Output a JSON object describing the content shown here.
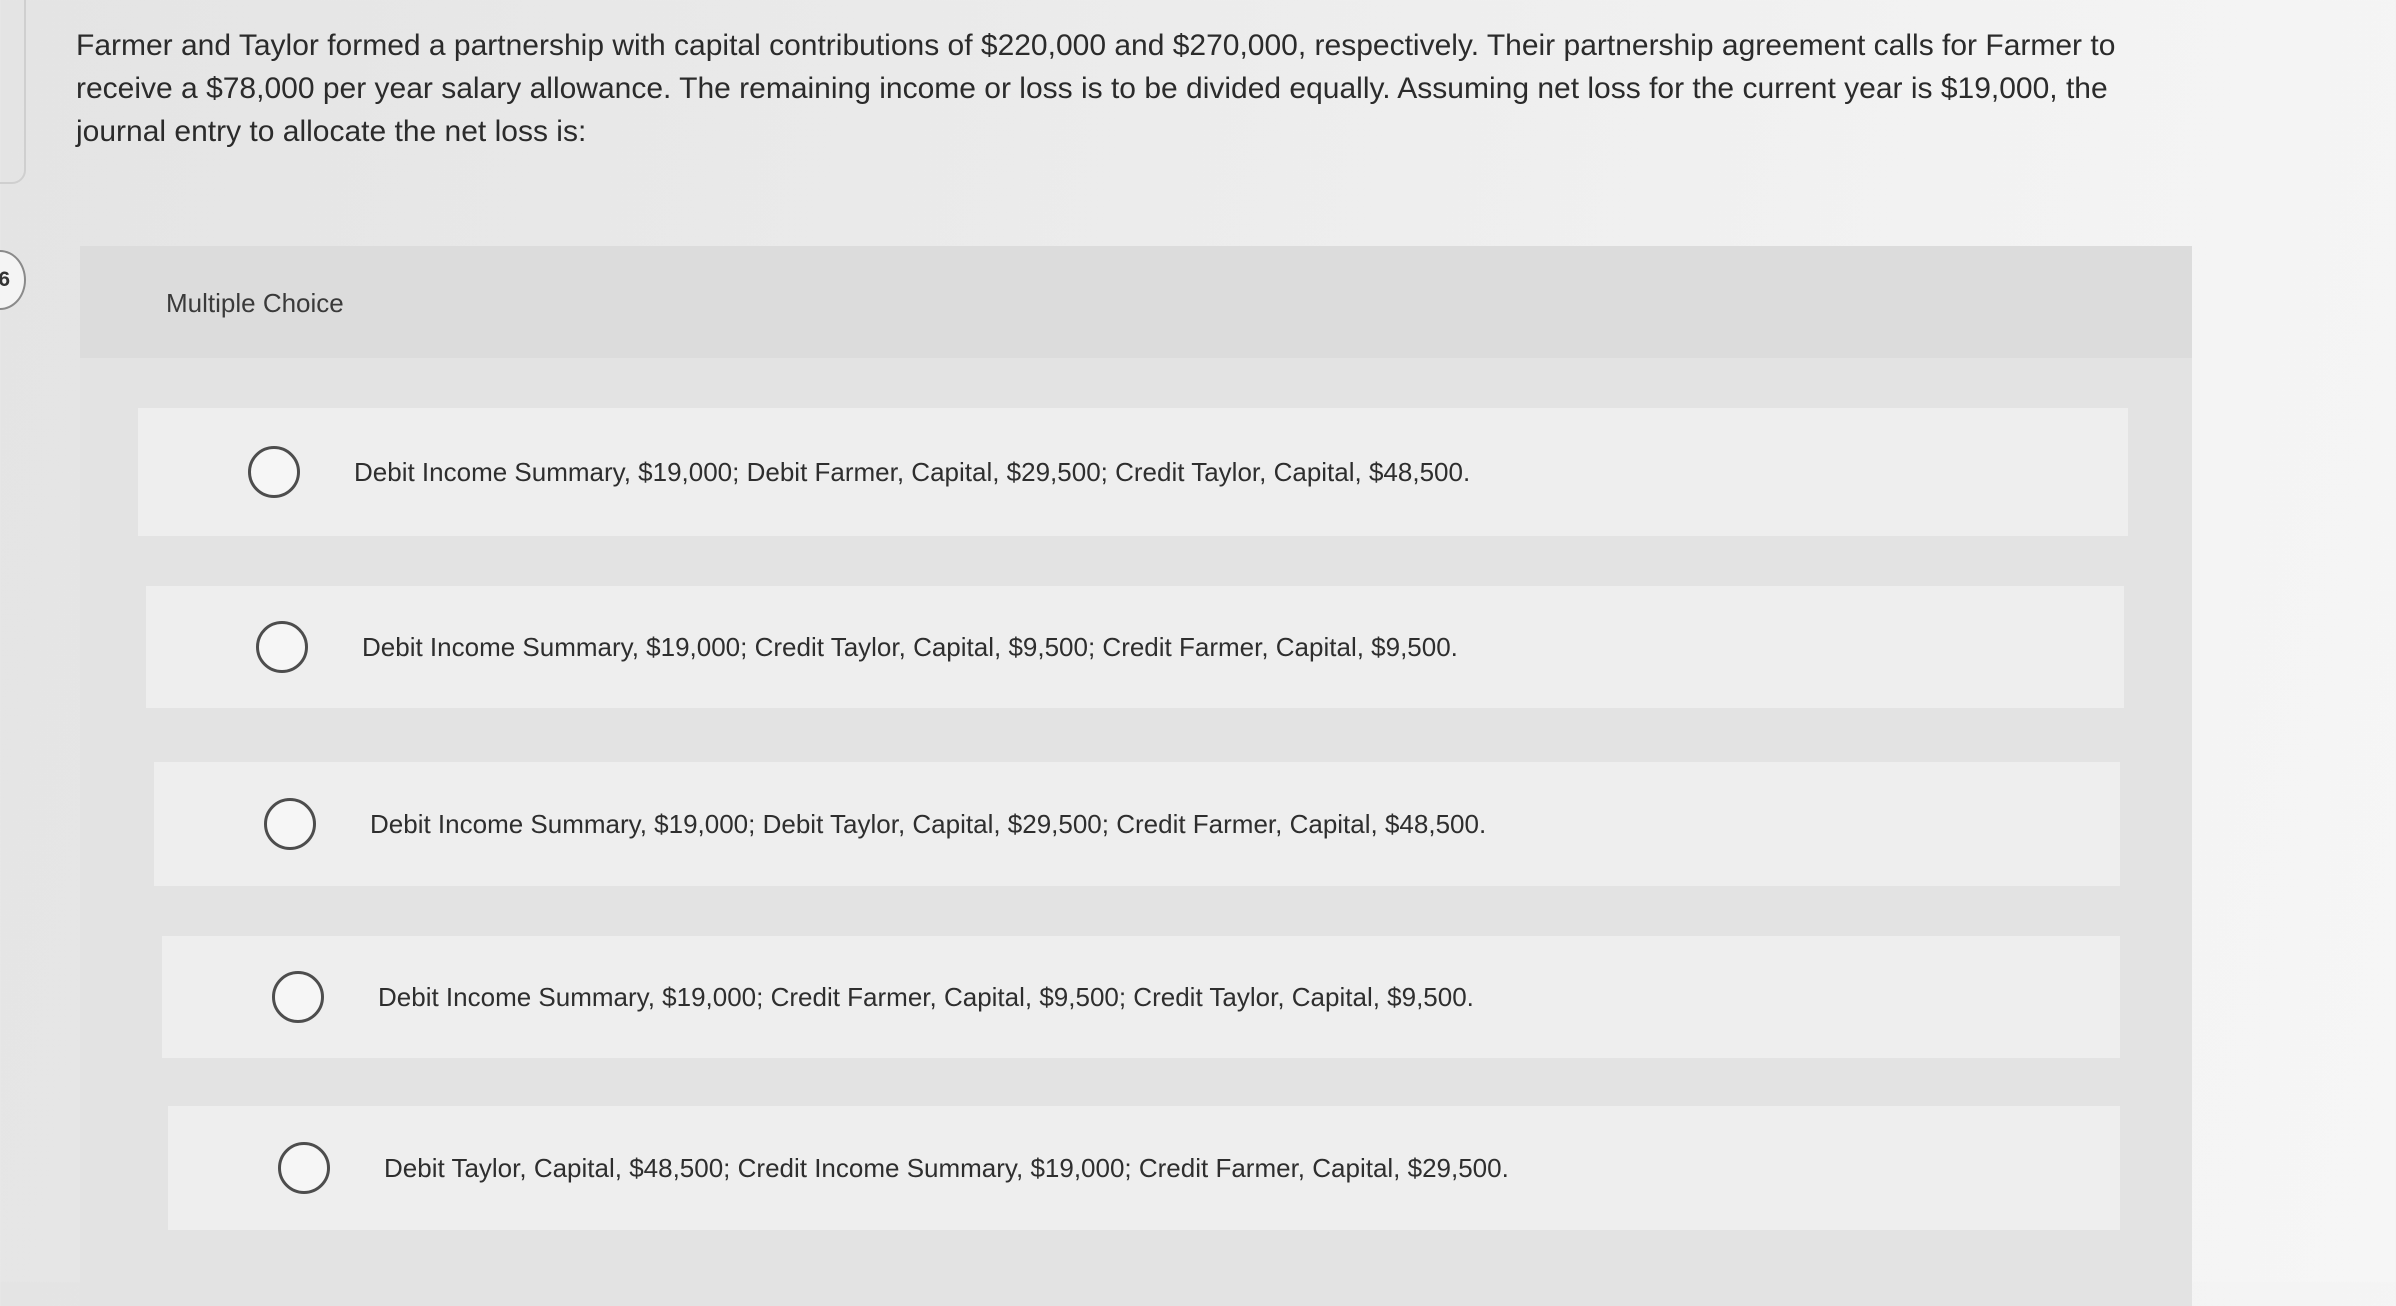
{
  "question": {
    "number": "6",
    "text": "Farmer and Taylor formed a partnership with capital contributions of $220,000 and $270,000, respectively. Their partnership agreement calls for Farmer to receive a $78,000 per year salary allowance. The remaining income or loss is to be divided equally. Assuming net loss for the current year is $19,000, the journal entry to allocate the net loss is:"
  },
  "multiple_choice": {
    "label": "Multiple Choice",
    "options": [
      {
        "text": "Debit Income Summary, $19,000; Debit Farmer, Capital, $29,500; Credit Taylor, Capital, $48,500."
      },
      {
        "text": "Debit Income Summary, $19,000; Credit Taylor, Capital, $9,500; Credit Farmer, Capital, $9,500."
      },
      {
        "text": "Debit Income Summary, $19,000; Debit Taylor, Capital, $29,500; Credit Farmer, Capital, $48,500."
      },
      {
        "text": "Debit Income Summary, $19,000; Credit Farmer, Capital, $9,500; Credit Taylor, Capital, $9,500."
      },
      {
        "text": "Debit Taylor, Capital, $48,500; Credit Income Summary, $19,000; Credit Farmer, Capital, $29,500."
      }
    ]
  },
  "icons": {
    "option_selector": "radio-button-icon"
  },
  "colors": {
    "background": "#ececec",
    "panel": "#e3e3e3",
    "option_bg": "#eeeeee",
    "radio_border": "#4d4d4d",
    "text": "#2a2a2a"
  }
}
